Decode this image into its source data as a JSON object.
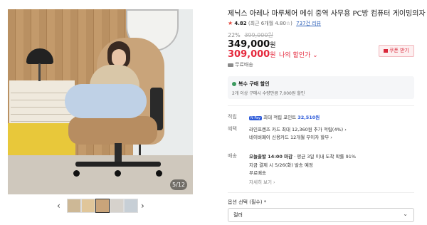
{
  "gallery": {
    "counter": "5/12",
    "prev_arrow": "‹",
    "next_arrow": "›",
    "thumb_count": 5,
    "selected_thumb": 3
  },
  "product": {
    "title": "제닉스 아레나 마루체어 메쉬 중역 사무용 PC방 컴퓨터 게이밍의자",
    "rating_star": "★",
    "rating": "4.82",
    "rating_detail": "(최근 6개월 4.80☆)",
    "reviews": "737건 리뷰",
    "discount_pct": "22%",
    "original_price": "399,000원",
    "price": "349,000",
    "price_unit": "원",
    "my_price": "309,000",
    "my_price_unit": "원",
    "my_price_label": "나의 할인가 ⌄",
    "coupon_label": "쿠폰 받기",
    "shipping_short": "무료배송"
  },
  "bundle": {
    "title": "복수 구매 할인",
    "desc": "2개 이상 구매시 수량만큼 7,000원 할인"
  },
  "rows": {
    "points": {
      "label": "적립",
      "badge": "N Pay",
      "text": "최대 적립 포인트 ",
      "value": "32,510원"
    },
    "benefit": {
      "label": "혜택",
      "line1": "라인프렌즈 카드 최대 12,360원 추가 적립(4%) ›",
      "line2": "네이버페이 신용카드 12개월 무이자 할부 ›"
    },
    "delivery": {
      "label": "배송",
      "today": "오늘출발 14:00 마감",
      "arrival": " · 평균 3일 이내 도착 확률 91%",
      "now_text": "지금 결제 시 5/26(화) 발송 예정",
      "fee": "무료배송",
      "detail": "자세히 보기 ›"
    }
  },
  "option": {
    "label": "옵션 선택 (필수) *",
    "select_value": "컬러",
    "chevron": "⌄"
  }
}
